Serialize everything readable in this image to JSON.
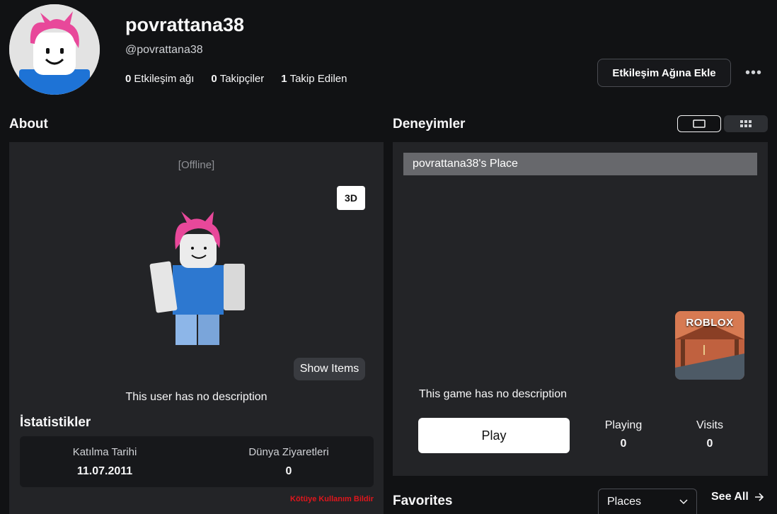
{
  "profile": {
    "display_name": "povrattana38",
    "handle": "@povrattana38",
    "stats": [
      {
        "value": "0",
        "label": "Etkileşim ağı"
      },
      {
        "value": "0",
        "label": "Takipçiler"
      },
      {
        "value": "1",
        "label": "Takip Edilen"
      }
    ],
    "add_button": "Etkileşim Ağına Ekle",
    "more_button": "•••"
  },
  "about": {
    "title": "About",
    "status": "[Offline]",
    "btn_3d": "3D",
    "show_items": "Show Items",
    "description": "This user has no description",
    "stats_title": "İstatistikler",
    "join_label": "Katılma Tarihi",
    "join_value": "11.07.2011",
    "visits_label": "Dünya Ziyaretleri",
    "visits_value": "0",
    "report": "Kötüye Kullanım Bildir"
  },
  "experiences": {
    "title": "Deneyimler",
    "game_name": "povrattana38's Place",
    "thumbnail_label": "ROBLOX",
    "description": "This game has no description",
    "play": "Play",
    "playing_label": "Playing",
    "playing_value": "0",
    "visits_label": "Visits",
    "visits_value": "0"
  },
  "favorites": {
    "title": "Favorites",
    "filter_selected": "Places",
    "see_all": "See All"
  },
  "colors": {
    "background": "#111214",
    "panel": "#232427",
    "report_red": "#e0161c"
  }
}
